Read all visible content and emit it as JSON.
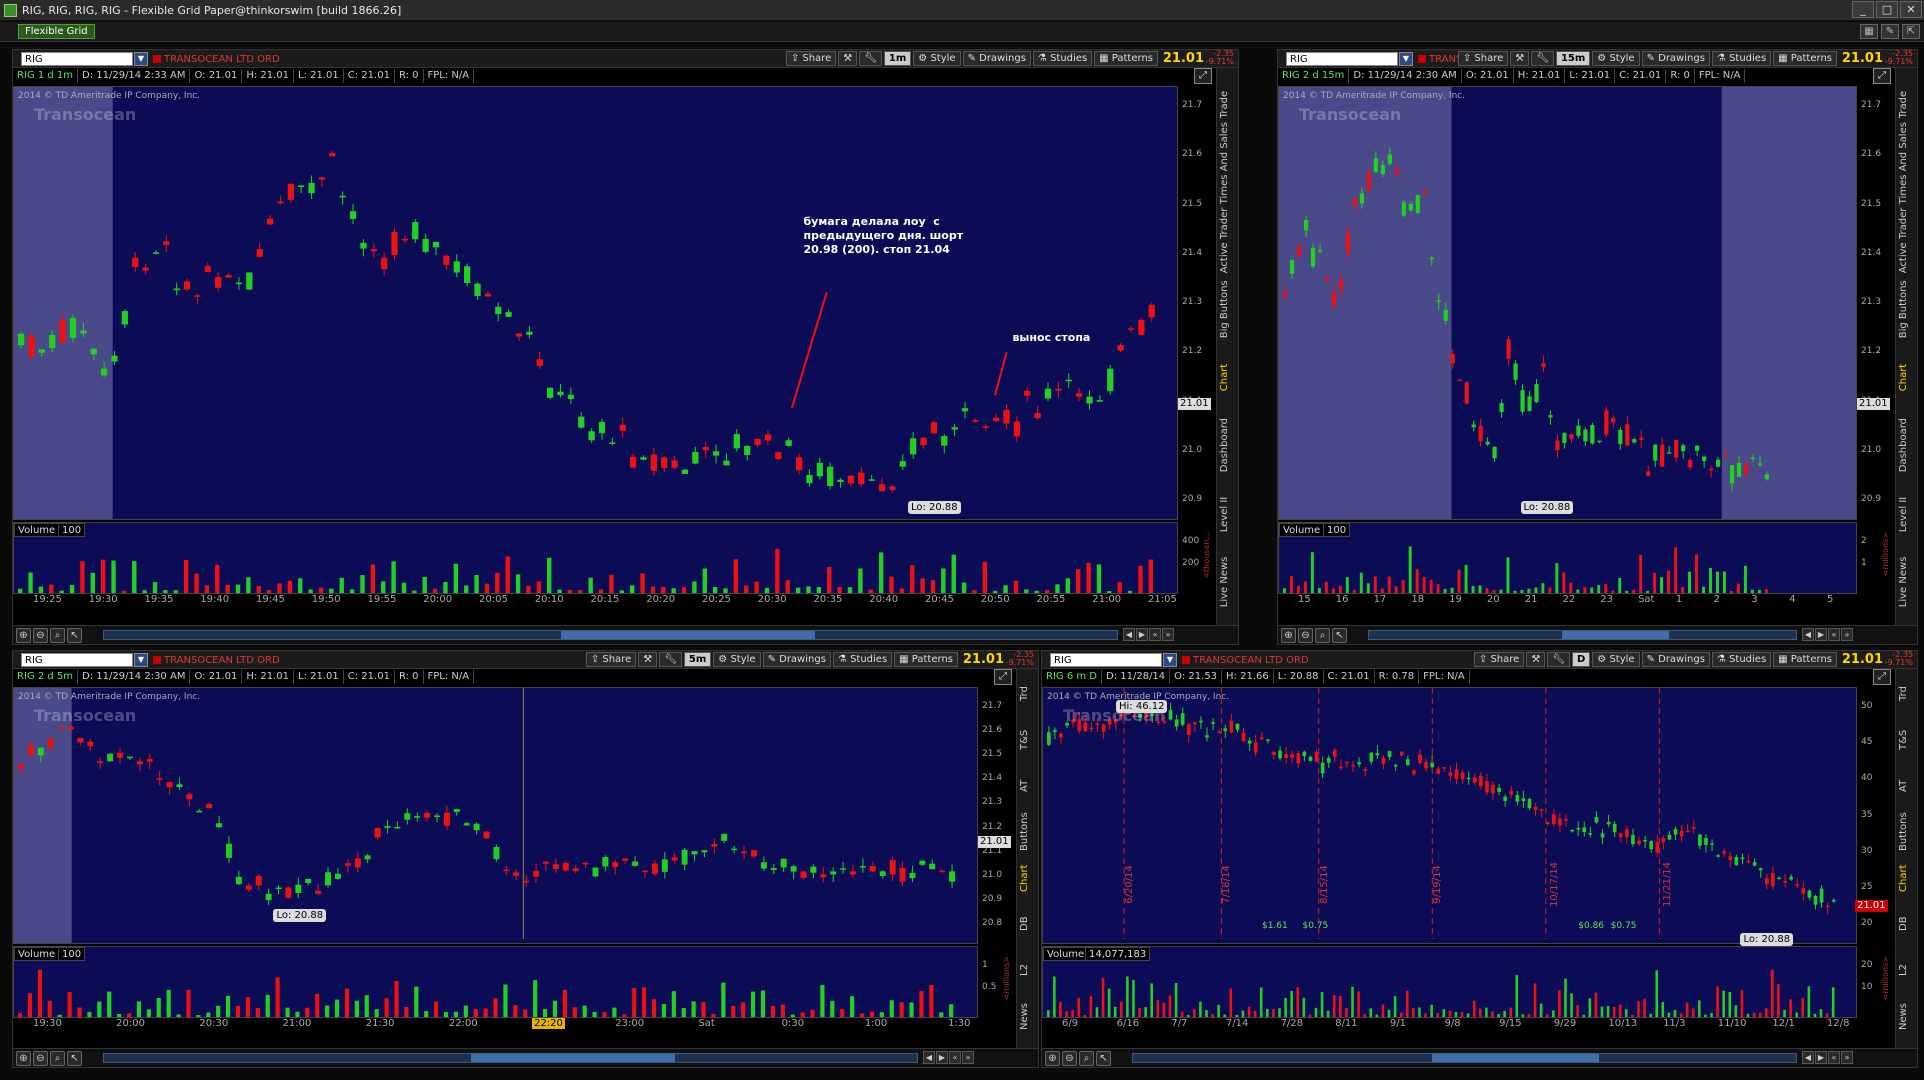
{
  "window": {
    "title": "RIG, RIG, RIG, RIG - Flexible Grid Paper@thinkorswim [build 1866.26]",
    "layout_label": "Flexible Grid"
  },
  "common": {
    "share": "Share",
    "style": "Style",
    "drawings": "Drawings",
    "studies": "Studies",
    "patterns": "Patterns",
    "volume": "Volume",
    "copyright": "2014 © TD Ameritrade IP Company, Inc.",
    "logo": "Transocean",
    "corp": "TRANSOCEAN LTD ORD",
    "corp_short": "TRANS...",
    "last": "21.01",
    "chg1": "-2.35",
    "chg2": "-9.71%",
    "colors": {
      "chart_bg": "#0c0c56",
      "up": "#22d022",
      "down": "#ee1111",
      "accent": "#ffd700"
    }
  },
  "panels": [
    {
      "id": "p1",
      "symbol": "RIG",
      "timeframe": "1m",
      "info": {
        "sid": "RIG 1 d 1m",
        "d": "D: 11/29/14 2:33 AM",
        "o": "O: 21.01",
        "h": "H: 21.01",
        "l": "L: 21.01",
        "c": "C: 21.01",
        "r": "R: 0",
        "fpl": "FPL: N/A"
      },
      "price_ticks": [
        "21.7",
        "21.6",
        "21.5",
        "21.4",
        "21.3",
        "21.2",
        "21.1",
        "21.0",
        "20.9"
      ],
      "price_tag": "21.01",
      "lo": "Lo: 20.88",
      "vol_value": "100",
      "vol_ticks": [
        "400",
        "200"
      ],
      "vol_unit": "<thousan...",
      "time_labels": [
        "19:25",
        "19:30",
        "19:35",
        "19:40",
        "19:45",
        "19:50",
        "19:55",
        "20:00",
        "20:05",
        "20:10",
        "20:15",
        "20:20",
        "20:25",
        "20:30",
        "20:35",
        "20:40",
        "20:45",
        "20:50",
        "20:55",
        "21:00",
        "21:05"
      ],
      "annotation1": "бумага делала лоу  с\nпредыдущего дня. шорт\n20.98 (200). стоп 21.04",
      "annotation2": "вынос стопа",
      "sidetabs": [
        "Trade",
        "Times And Sales",
        "Active Trader",
        "Big Buttons",
        "Chart",
        "Dashboard",
        "Level II",
        "Live News"
      ],
      "active_tab": "Chart"
    },
    {
      "id": "p2",
      "symbol": "RIG",
      "timeframe": "15m",
      "info": {
        "sid": "RIG 2 d 15m",
        "d": "D: 11/29/14 2:30 AM",
        "o": "O: 21.01",
        "h": "H: 21.01",
        "l": "L: 21.01",
        "c": "C: 21.01",
        "r": "R: 0",
        "fpl": "FPL: N/A"
      },
      "price_ticks": [
        "21.7",
        "21.6",
        "21.5",
        "21.4",
        "21.3",
        "21.2",
        "21.1",
        "21.0",
        "20.9"
      ],
      "price_tag": "21.01",
      "lo": "Lo: 20.88",
      "vol_value": "100",
      "vol_ticks": [
        "2",
        "1"
      ],
      "vol_unit": "<millions>",
      "time_labels": [
        "15",
        "16",
        "17",
        "18",
        "19",
        "20",
        "21",
        "22",
        "23",
        "Sat",
        "1",
        "2",
        "3",
        "4",
        "5"
      ],
      "sidetabs": [
        "Trade",
        "Times And Sales",
        "Active Trader",
        "Big Buttons",
        "Chart",
        "Dashboard",
        "Level II",
        "Live News"
      ],
      "active_tab": "Chart"
    },
    {
      "id": "p3",
      "symbol": "RIG",
      "timeframe": "5m",
      "info": {
        "sid": "RIG 2 d 5m",
        "d": "D: 11/29/14 2:30 AM",
        "o": "O: 21.01",
        "h": "H: 21.01",
        "l": "L: 21.01",
        "c": "C: 21.01",
        "r": "R: 0",
        "fpl": "FPL: N/A"
      },
      "price_ticks": [
        "21.7",
        "21.6",
        "21.5",
        "21.4",
        "21.3",
        "21.2",
        "21.1",
        "21.0",
        "20.9",
        "20.8"
      ],
      "price_tag": "21.01",
      "lo": "Lo: 20.88",
      "vol_value": "100",
      "vol_ticks": [
        "1",
        "0.5"
      ],
      "vol_unit": "<millions>",
      "time_labels": [
        "19:30",
        "20:00",
        "20:30",
        "21:00",
        "21:30",
        "22:00",
        "22:20",
        "23:00",
        "Sat",
        "0:30",
        "1:00",
        "1:30"
      ],
      "time_highlight": "22:20",
      "sidetabs": [
        "Trd",
        "T&S",
        "AT",
        "Buttons",
        "Chart",
        "DB",
        "L2",
        "News"
      ],
      "active_tab": "Chart"
    },
    {
      "id": "p4",
      "symbol": "RIG",
      "timeframe": "D",
      "info": {
        "sid": "RIG 6 m D",
        "d": "D: 11/28/14",
        "o": "O: 21.53",
        "h": "H: 21.66",
        "l": "L: 20.88",
        "c": "C: 21.01",
        "r": "R: 0.78",
        "fpl": "FPL: N/A"
      },
      "price_ticks": [
        "50",
        "45",
        "40",
        "35",
        "30",
        "25",
        "20"
      ],
      "price_tag": "21.01",
      "lo": "Lo: 20.88",
      "hi": "Hi: 46.12",
      "vol_value": "14,077,183",
      "vol_ticks": [
        "20",
        "10"
      ],
      "vol_unit": "<millions>",
      "time_labels": [
        "6/9",
        "6/16",
        "7/7",
        "7/14",
        "7/28",
        "8/11",
        "9/1",
        "9/8",
        "9/15",
        "9/29",
        "10/13",
        "11/3",
        "11/10",
        "12/1",
        "12/8"
      ],
      "event_dates": [
        "6/20/14",
        "7/18/14",
        "8/15/14",
        "9/19/14",
        "10/17/14",
        "11/21/14"
      ],
      "div_labels": [
        "$1.61",
        "$0.75",
        "$0.86",
        "$0.75"
      ],
      "sidetabs": [
        "Trd",
        "T&S",
        "AT",
        "Buttons",
        "Chart",
        "DB",
        "L2",
        "News"
      ],
      "active_tab": "Chart"
    }
  ]
}
